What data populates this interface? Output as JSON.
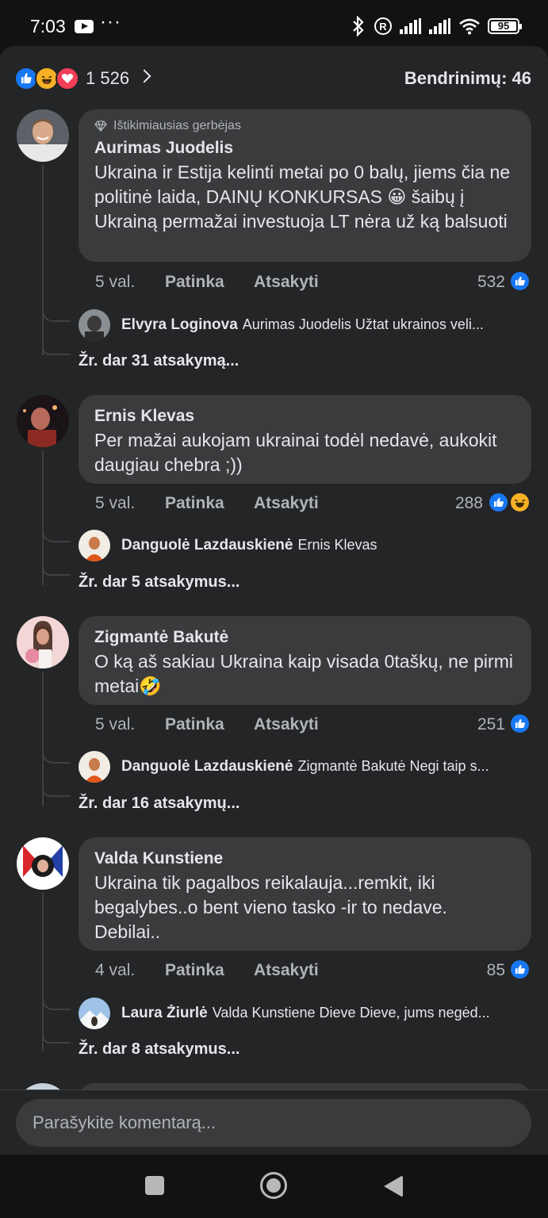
{
  "status_bar": {
    "time": "7:03",
    "battery": "95",
    "icons": [
      "youtube-icon",
      "more-dots-icon",
      "bluetooth-icon",
      "registered-icon",
      "signal-icon",
      "signal-icon",
      "wifi-icon",
      "battery-icon"
    ]
  },
  "reactions": {
    "count": "1 526",
    "types": [
      "like",
      "haha",
      "love"
    ],
    "shares": "Bendrinimų: 46"
  },
  "comments": [
    {
      "badge": "Ištikimiausias gerbėjas",
      "author": "Aurimas Juodelis",
      "text": "Ukraina ir Estija kelinti metai po 0 balų, jiems čia ne politinė laida, DAINŲ KONKURSAS 😀 šaibų į Ukrainą permažai investuoja LT nėra už ką balsuoti",
      "time": "5 val.",
      "like_label": "Patinka",
      "reply_label": "Atsakyti",
      "reaction_count": "532",
      "reply": {
        "author": "Elvyra Loginova",
        "text": "Aurimas Juodelis Užtat ukrainos veli..."
      },
      "more_replies": "Žr. dar 31 atsakymą..."
    },
    {
      "author": "Ernis Klevas",
      "text": "Per mažai aukojam ukrainai todėl nedavė, aukokit daugiau chebra ;))",
      "time": "5 val.",
      "like_label": "Patinka",
      "reply_label": "Atsakyti",
      "reaction_count": "288",
      "reply": {
        "author": "Danguolė Lazdauskienė",
        "text": "Ernis Klevas"
      },
      "more_replies": "Žr. dar 5 atsakymus..."
    },
    {
      "author": "Zigmantė Bakutė",
      "text": "O ką aš sakiau Ukraina kaip visada 0taškų, ne pirmi metai🤣",
      "time": "5 val.",
      "like_label": "Patinka",
      "reply_label": "Atsakyti",
      "reaction_count": "251",
      "reply": {
        "author": "Danguolė Lazdauskienė",
        "text": "Zigmantė Bakutė Negi taip s..."
      },
      "more_replies": "Žr. dar 16 atsakymų..."
    },
    {
      "author": "Valda Kunstiene",
      "text": "Ukraina tik pagalbos reikalauja...remkit, iki begalybes..o bent vieno tasko -ir to nedave. Debilai..",
      "time": "4 val.",
      "like_label": "Patinka",
      "reply_label": "Atsakyti",
      "reaction_count": "85",
      "reply": {
        "author": "Laura Žiurlė",
        "text": "Valda Kunstiene Dieve Dieve, jums negėd..."
      },
      "more_replies": "Žr. dar 8 atsakymus..."
    }
  ],
  "composer": {
    "placeholder": "Parašykite komentarą..."
  },
  "nav": {
    "icons": [
      "recents-icon",
      "home-icon",
      "back-icon"
    ]
  }
}
